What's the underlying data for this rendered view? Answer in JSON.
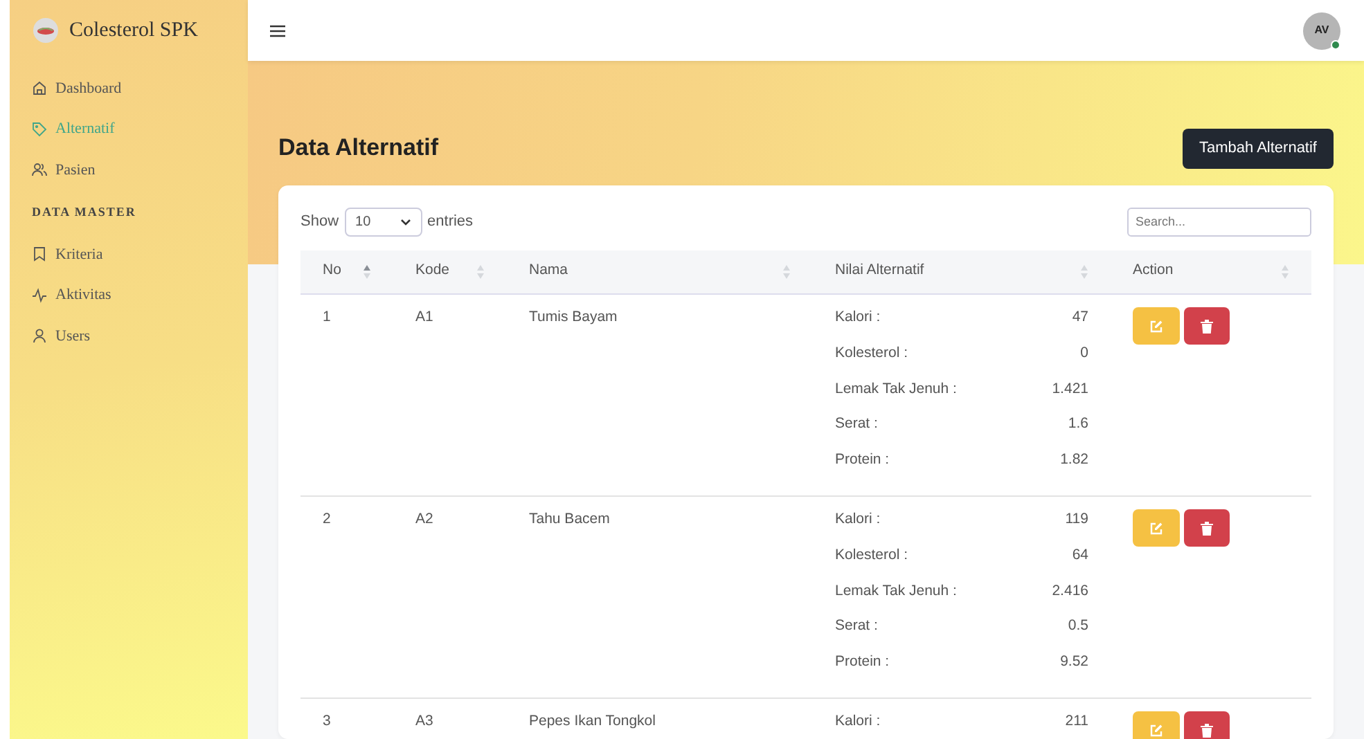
{
  "brand": {
    "title": "Colesterol SPK"
  },
  "sidebar": {
    "items": [
      {
        "kind": "link",
        "label": "Dashboard",
        "selected": false
      },
      {
        "kind": "link",
        "label": "Alternatif",
        "selected": true
      },
      {
        "kind": "link",
        "label": "Pasien",
        "selected": false
      },
      {
        "kind": "heading",
        "label": "DATA MASTER"
      },
      {
        "kind": "link",
        "label": "Kriteria",
        "selected": false
      },
      {
        "kind": "link",
        "label": "Aktivitas",
        "selected": false
      },
      {
        "kind": "link",
        "label": "Users",
        "selected": false
      }
    ]
  },
  "header": {
    "avatar": "AV",
    "online": true
  },
  "page": {
    "title": "Data Alternatif",
    "add_button": "Tambah Alternatif"
  },
  "table_controls": {
    "show_label": "Show",
    "page_size": "10",
    "entries_label": "entries",
    "search": {
      "placeholder": "Search..."
    }
  },
  "table": {
    "columns": [
      {
        "label": "No",
        "sorted": true
      },
      {
        "label": "Kode",
        "sorted": false
      },
      {
        "label": "Nama",
        "sorted": false
      },
      {
        "label": "Nilai Alternatif",
        "sorted": false
      },
      {
        "label": "Action",
        "sorted": false
      }
    ],
    "rows": [
      {
        "no": "1",
        "kode": "A1",
        "nama": "Tumis Bayam",
        "nilai": [
          {
            "label": "Kalori :",
            "value": "47"
          },
          {
            "label": "Kolesterol :",
            "value": "0"
          },
          {
            "label": "Lemak Tak Jenuh :",
            "value": "1.421"
          },
          {
            "label": "Serat :",
            "value": "1.6"
          },
          {
            "label": "Protein :",
            "value": "1.82"
          }
        ]
      },
      {
        "no": "2",
        "kode": "A2",
        "nama": "Tahu Bacem",
        "nilai": [
          {
            "label": "Kalori :",
            "value": "119"
          },
          {
            "label": "Kolesterol :",
            "value": "64"
          },
          {
            "label": "Lemak Tak Jenuh :",
            "value": "2.416"
          },
          {
            "label": "Serat :",
            "value": "0.5"
          },
          {
            "label": "Protein :",
            "value": "9.52"
          }
        ]
      },
      {
        "no": "3",
        "kode": "A3",
        "nama": "Pepes Ikan Tongkol",
        "nilai": [
          {
            "label": "Kalori :",
            "value": "211"
          }
        ]
      }
    ]
  }
}
